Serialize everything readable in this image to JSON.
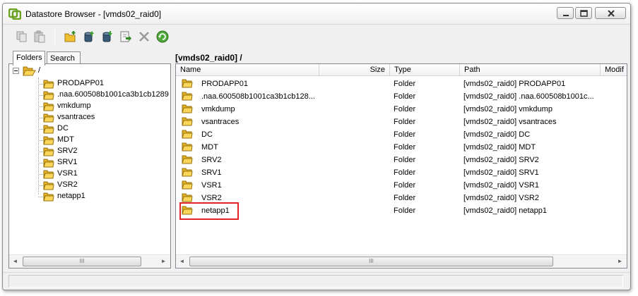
{
  "window": {
    "title": "Datastore Browser - [vmds02_raid0]",
    "accent_color": "#6aa121"
  },
  "toolbar": {
    "buttons": [
      {
        "name": "copy-icon",
        "tooltip": ""
      },
      {
        "name": "paste-icon",
        "tooltip": ""
      },
      {
        "name": "new-folder-icon",
        "tooltip": ""
      },
      {
        "name": "upload-icon",
        "tooltip": ""
      },
      {
        "name": "download-icon",
        "tooltip": ""
      },
      {
        "name": "move-icon",
        "tooltip": ""
      },
      {
        "name": "delete-icon",
        "tooltip": ""
      },
      {
        "name": "refresh-icon",
        "tooltip": ""
      }
    ]
  },
  "left": {
    "tabs": {
      "folders": "Folders",
      "search": "Search"
    },
    "root_label": "/",
    "tree": [
      {
        "label": "PRODAPP01"
      },
      {
        "label": ".naa.600508b1001ca3b1cb1289"
      },
      {
        "label": "vmkdump"
      },
      {
        "label": "vsantraces"
      },
      {
        "label": "DC"
      },
      {
        "label": "MDT"
      },
      {
        "label": "SRV2"
      },
      {
        "label": "SRV1"
      },
      {
        "label": "VSR1"
      },
      {
        "label": "VSR2"
      },
      {
        "label": "netapp1"
      }
    ]
  },
  "right": {
    "path": "[vmds02_raid0] /",
    "columns": {
      "name": "Name",
      "size": "Size",
      "type": "Type",
      "path": "Path",
      "modified": "Modif"
    },
    "rows": [
      {
        "name": "PRODAPP01",
        "type": "Folder",
        "path": "[vmds02_raid0] PRODAPP01"
      },
      {
        "name": ".naa.600508b1001ca3b1cb128...",
        "type": "Folder",
        "path": "[vmds02_raid0] .naa.600508b1001c..."
      },
      {
        "name": "vmkdump",
        "type": "Folder",
        "path": "[vmds02_raid0] vmkdump"
      },
      {
        "name": "vsantraces",
        "type": "Folder",
        "path": "[vmds02_raid0] vsantraces"
      },
      {
        "name": "DC",
        "type": "Folder",
        "path": "[vmds02_raid0] DC"
      },
      {
        "name": "MDT",
        "type": "Folder",
        "path": "[vmds02_raid0] MDT"
      },
      {
        "name": "SRV2",
        "type": "Folder",
        "path": "[vmds02_raid0] SRV2"
      },
      {
        "name": "SRV1",
        "type": "Folder",
        "path": "[vmds02_raid0] SRV1"
      },
      {
        "name": "VSR1",
        "type": "Folder",
        "path": "[vmds02_raid0] VSR1"
      },
      {
        "name": "VSR2",
        "type": "Folder",
        "path": "[vmds02_raid0] VSR2"
      },
      {
        "name": "netapp1",
        "type": "Folder",
        "path": "[vmds02_raid0] netapp1",
        "highlighted": true
      }
    ],
    "highlight_color": "#e0242a"
  },
  "icons": {
    "folder": "folder-icon",
    "scroll_left": "◄",
    "scroll_right": "►",
    "scroll_grip": "III"
  }
}
